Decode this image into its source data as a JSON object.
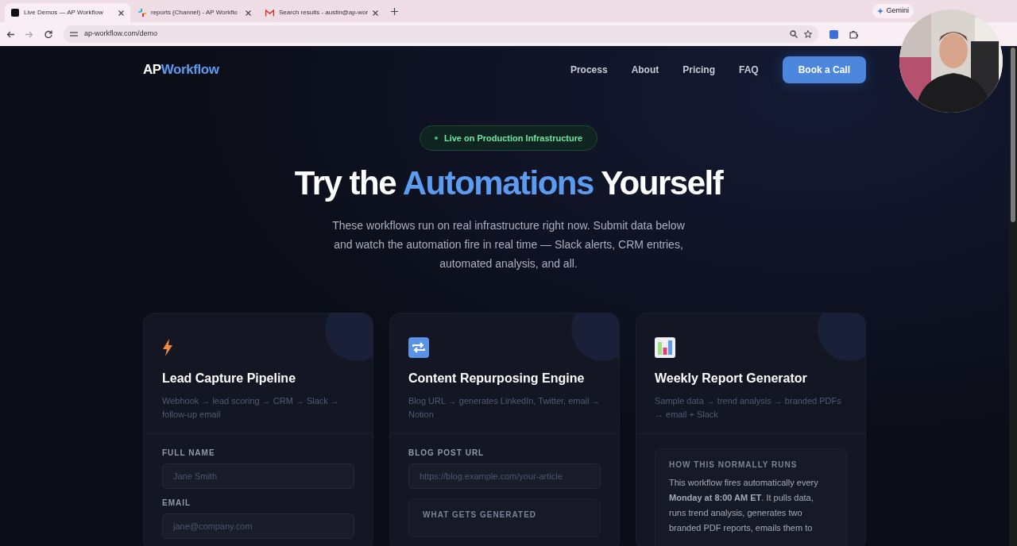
{
  "browser": {
    "tabs": [
      {
        "title": "Live Demos — AP Workflow",
        "selected": true,
        "kind": "ap"
      },
      {
        "title": "reports (Channel) - AP Workflo",
        "selected": false,
        "kind": "slack"
      },
      {
        "title": "Search results - austin@ap-wor",
        "selected": false,
        "kind": "mail"
      }
    ],
    "gemini": "Gemini",
    "url": "ap-workflow.com/demo"
  },
  "nav": {
    "logo_prefix": "AP",
    "logo_suffix": "Workflow",
    "links": [
      "Process",
      "About",
      "Pricing",
      "FAQ"
    ],
    "cta": "Book a Call"
  },
  "hero": {
    "badge": "Live on Production Infrastructure",
    "title_before": "Try the ",
    "title_highlight": "Automations",
    "title_after": " Yourself",
    "subtitle": "These workflows run on real infrastructure right now. Submit data below and watch the automation fire in real time — Slack alerts, CRM entries, automated analysis, and all."
  },
  "cards": [
    {
      "kind": "bolt",
      "title": "Lead Capture Pipeline",
      "flow": "Webhook → lead scoring → CRM → Slack → follow-up email",
      "fields": [
        {
          "label": "FULL NAME",
          "placeholder": "Jane Smith"
        },
        {
          "label": "EMAIL",
          "placeholder": "jane@company.com"
        }
      ]
    },
    {
      "kind": "repeat",
      "title": "Content Repurposing Engine",
      "flow": "Blog URL → generates LinkedIn, Twitter, email → Notion",
      "fields": [
        {
          "label": "BLOG POST URL",
          "placeholder": "https://blog.example.com/your-article"
        }
      ],
      "info": {
        "heading": "WHAT GETS GENERATED"
      }
    },
    {
      "kind": "chart",
      "title": "Weekly Report Generator",
      "flow": "Sample data → trend analysis → branded PDFs → email + Slack",
      "info": {
        "heading": "HOW THIS NORMALLY RUNS",
        "text": "This workflow fires automatically every **Monday at 8:00 AM ET**. It pulls data, runs trend analysis, generates two branded PDF reports, emails them to"
      }
    }
  ]
}
